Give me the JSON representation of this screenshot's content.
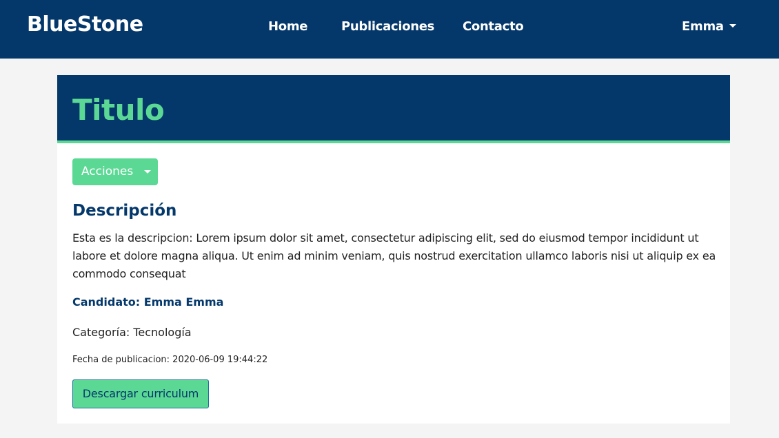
{
  "navbar": {
    "brand": "BlueStone",
    "links": [
      {
        "label": "Home"
      },
      {
        "label": "Publicaciones"
      },
      {
        "label": "Contacto"
      }
    ],
    "user": "Emma"
  },
  "colors": {
    "primary": "#04386b",
    "accent": "#5cd895",
    "background": "#f4f4f4"
  },
  "card": {
    "title": "Titulo",
    "actions_label": "Acciones",
    "description_heading": "Descripción",
    "description": "Esta es la descripcion: Lorem ipsum dolor sit amet, consectetur adipiscing elit, sed do eiusmod tempor incididunt ut labore et dolore magna aliqua. Ut enim ad minim veniam, quis nostrud exercitation ullamco laboris nisi ut aliquip ex ea commodo consequat",
    "candidate": "Candidato: Emma Emma",
    "category": "Categoría: Tecnología",
    "published": "Fecha de publicacion: 2020-06-09 19:44:22",
    "download_label": "Descargar curriculum"
  },
  "icons": {
    "user_menu": "chevron-down-icon",
    "actions_menu": "chevron-down-icon"
  }
}
